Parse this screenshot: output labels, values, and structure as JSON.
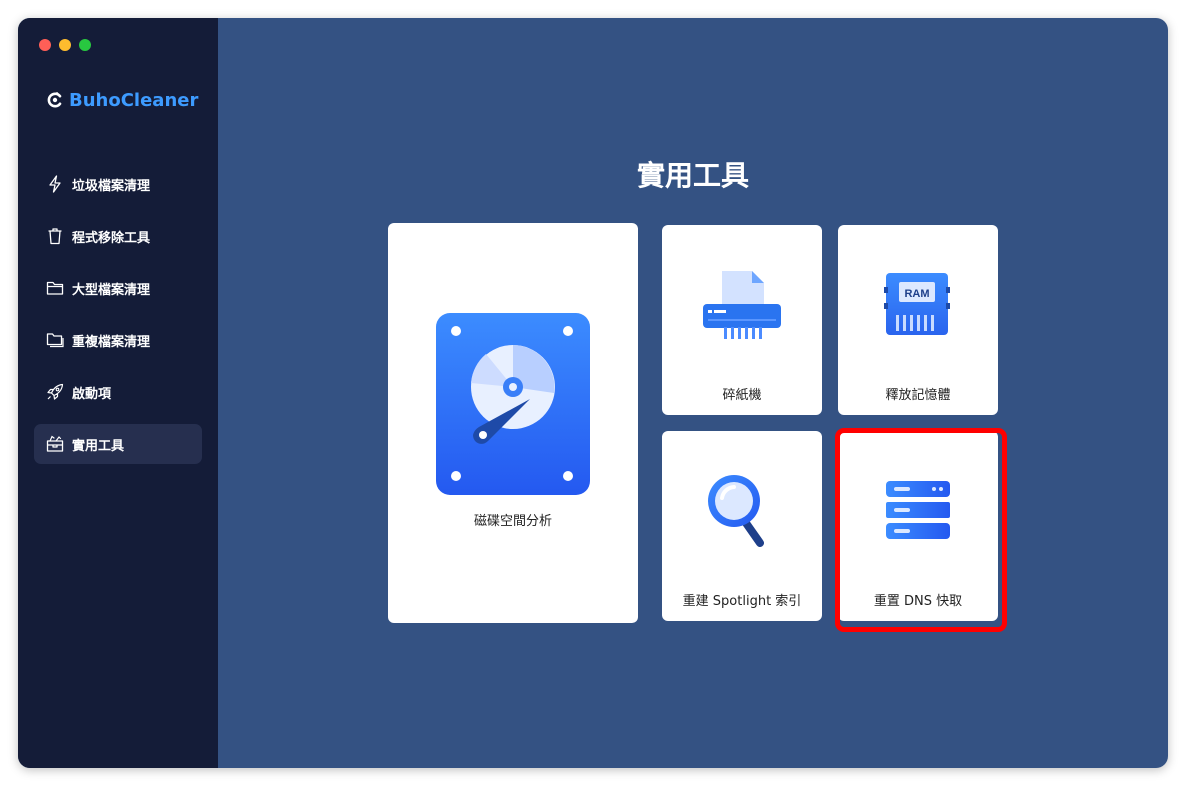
{
  "app": {
    "name": "BuhoCleaner",
    "brand_color": "#3d9bff"
  },
  "window_controls": [
    "close",
    "minimize",
    "zoom"
  ],
  "sidebar": {
    "items": [
      {
        "label": "垃圾檔案清理",
        "icon": "bolt-icon",
        "active": false
      },
      {
        "label": "程式移除工具",
        "icon": "trash-icon",
        "active": false
      },
      {
        "label": "大型檔案清理",
        "icon": "folder-icon",
        "active": false
      },
      {
        "label": "重複檔案清理",
        "icon": "duplicate-folder-icon",
        "active": false
      },
      {
        "label": "啟動項",
        "icon": "rocket-icon",
        "active": false
      },
      {
        "label": "實用工具",
        "icon": "toolbox-icon",
        "active": true
      }
    ]
  },
  "main": {
    "title": "實用工具",
    "tools": [
      {
        "label": "磁碟空間分析",
        "icon": "disk-analyzer-icon"
      },
      {
        "label": "碎紙機",
        "icon": "shredder-icon"
      },
      {
        "label": "釋放記憶體",
        "icon": "ram-icon",
        "icon_text": "RAM"
      },
      {
        "label": "重建 Spotlight 索引",
        "icon": "magnifier-icon"
      },
      {
        "label": "重置 DNS 快取",
        "icon": "server-icon",
        "highlighted": true
      }
    ]
  },
  "colors": {
    "sidebar_bg": "#141c38",
    "main_bg": "#345283",
    "highlight": "#ff0000"
  }
}
